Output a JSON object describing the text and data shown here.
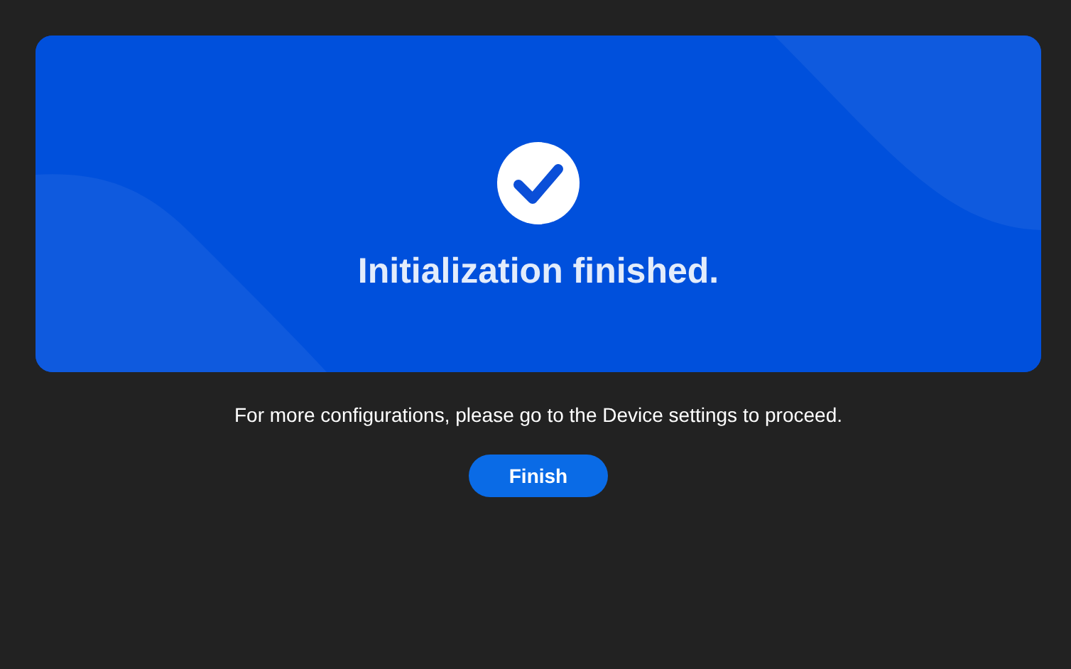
{
  "banner": {
    "title": "Initialization finished."
  },
  "message": "For more configurations, please go to the Device settings to proceed.",
  "buttons": [
    {
      "label": "Finish"
    }
  ]
}
